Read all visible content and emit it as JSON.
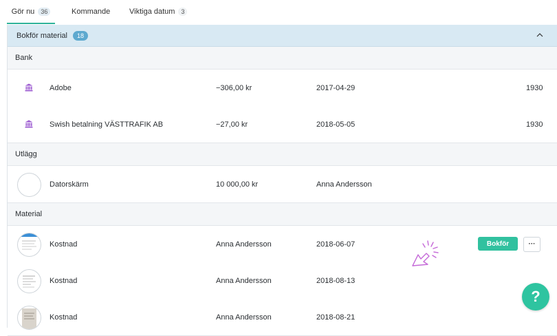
{
  "tabs": [
    {
      "label": "Gör nu",
      "count": "36"
    },
    {
      "label": "Kommande"
    },
    {
      "label": "Viktiga datum",
      "count": "3"
    }
  ],
  "panel": {
    "title": "Bokför material",
    "count": "18"
  },
  "sections": {
    "bank": "Bank",
    "utlagg": "Utlägg",
    "material": "Material"
  },
  "bank_rows": [
    {
      "name": "Adobe",
      "amount": "−306,00 kr",
      "date": "2017-04-29",
      "account": "1930"
    },
    {
      "name": "Swish betalning VÄSTTRAFIK AB",
      "amount": "−27,00 kr",
      "date": "2018-05-05",
      "account": "1930"
    }
  ],
  "utlagg_rows": [
    {
      "name": "Datorskärm",
      "amount": "10 000,00 kr",
      "person": "Anna Andersson"
    }
  ],
  "material_rows": [
    {
      "name": "Kostnad",
      "person": "Anna Andersson",
      "date": "2018-06-07"
    },
    {
      "name": "Kostnad",
      "person": "Anna Andersson",
      "date": "2018-08-13"
    },
    {
      "name": "Kostnad",
      "person": "Anna Andersson",
      "date": "2018-08-21"
    }
  ],
  "actions": {
    "bokfor_label": "Bokför",
    "more_label": "···"
  },
  "help": {
    "label": "?"
  },
  "colors": {
    "accent": "#31c19f",
    "header_bg": "#d8e9f3",
    "badge": "#5ea9cf",
    "bank_icon": "#9b59d0"
  },
  "icons": [
    "bank-icon",
    "chevron-up-icon",
    "more-icon",
    "cursor-icon",
    "help-icon"
  ]
}
